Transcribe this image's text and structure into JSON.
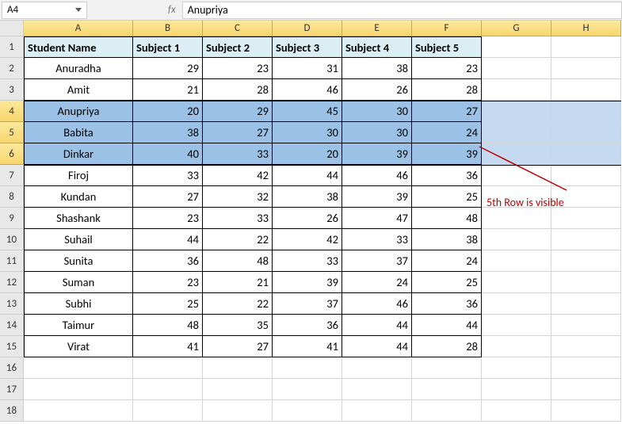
{
  "namebox": {
    "value": "A4"
  },
  "fx_label": "fx",
  "formula": {
    "value": "Anupriya"
  },
  "columns": [
    "A",
    "B",
    "C",
    "D",
    "E",
    "F",
    "G",
    "H"
  ],
  "row_numbers": [
    "1",
    "2",
    "3",
    "4",
    "5",
    "6",
    "7",
    "8",
    "9",
    "10",
    "11",
    "12",
    "13",
    "14",
    "15",
    "16",
    "17",
    "18"
  ],
  "headers": {
    "A": "Student Name",
    "B": "Subject 1",
    "C": "Subject 2",
    "D": "Subject 3",
    "E": "Subject 4",
    "F": "Subject 5"
  },
  "rows": [
    {
      "name": "Anuradha",
      "s1": "29",
      "s2": "23",
      "s3": "31",
      "s4": "38",
      "s5": "23"
    },
    {
      "name": "Amit",
      "s1": "21",
      "s2": "28",
      "s3": "46",
      "s4": "26",
      "s5": "28"
    },
    {
      "name": "Anupriya",
      "s1": "20",
      "s2": "29",
      "s3": "45",
      "s4": "30",
      "s5": "27"
    },
    {
      "name": "Babita",
      "s1": "38",
      "s2": "27",
      "s3": "30",
      "s4": "30",
      "s5": "24"
    },
    {
      "name": "Dinkar",
      "s1": "40",
      "s2": "33",
      "s3": "20",
      "s4": "39",
      "s5": "39"
    },
    {
      "name": "Firoj",
      "s1": "33",
      "s2": "42",
      "s3": "44",
      "s4": "46",
      "s5": "36"
    },
    {
      "name": "Kundan",
      "s1": "27",
      "s2": "32",
      "s3": "38",
      "s4": "39",
      "s5": "25"
    },
    {
      "name": "Shashank",
      "s1": "23",
      "s2": "33",
      "s3": "26",
      "s4": "47",
      "s5": "48"
    },
    {
      "name": "Suhail",
      "s1": "44",
      "s2": "22",
      "s3": "42",
      "s4": "33",
      "s5": "38"
    },
    {
      "name": "Sunita",
      "s1": "36",
      "s2": "48",
      "s3": "33",
      "s4": "37",
      "s5": "24"
    },
    {
      "name": "Suman",
      "s1": "23",
      "s2": "21",
      "s3": "39",
      "s4": "24",
      "s5": "25"
    },
    {
      "name": "Subhi",
      "s1": "25",
      "s2": "22",
      "s3": "37",
      "s4": "46",
      "s5": "36"
    },
    {
      "name": "Taimur",
      "s1": "48",
      "s2": "35",
      "s3": "36",
      "s4": "44",
      "s5": "44"
    },
    {
      "name": "Virat",
      "s1": "41",
      "s2": "27",
      "s3": "41",
      "s4": "44",
      "s5": "28"
    }
  ],
  "selected_rows": [
    4,
    5,
    6
  ],
  "annotation": "5th Row is visible"
}
